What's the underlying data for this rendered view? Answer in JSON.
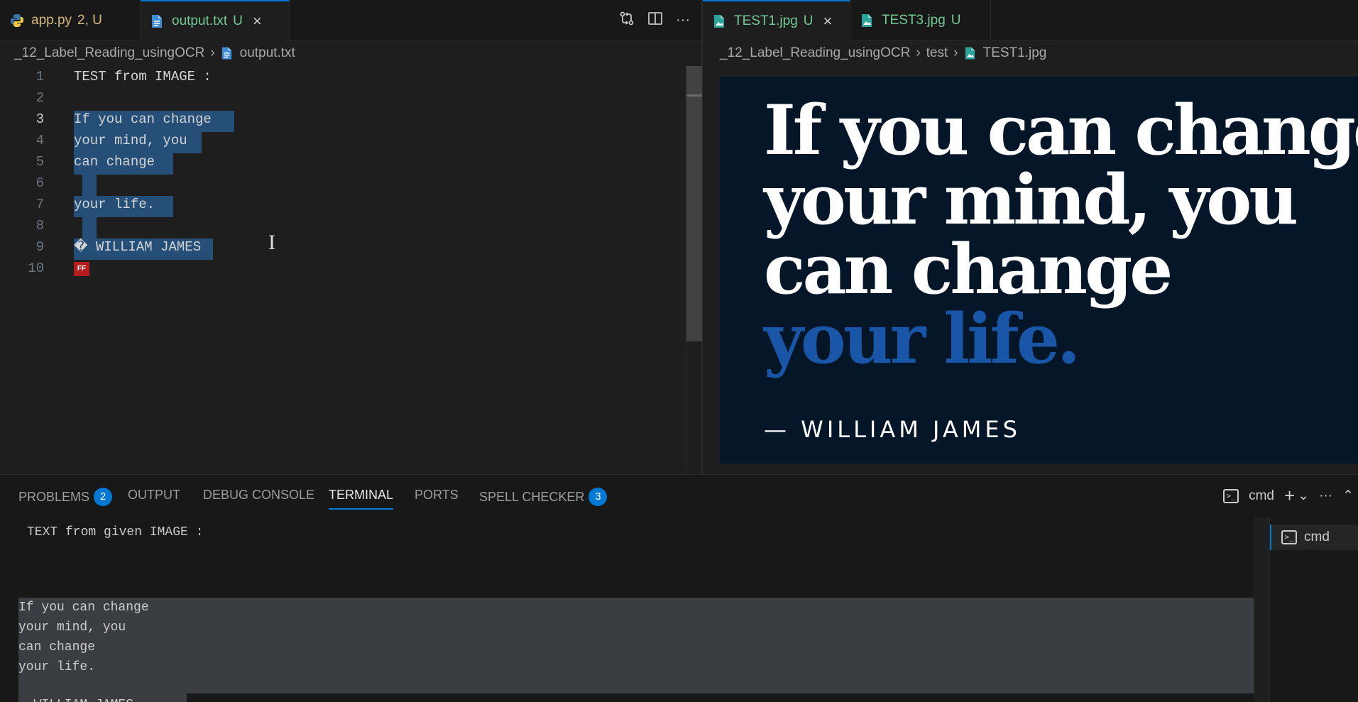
{
  "colors": {
    "accent": "#0078d4",
    "selection": "#264f78",
    "modified": "#d7ba7d",
    "untracked": "#73c991",
    "image_bg": "#051629",
    "image_blue_text": "#1a56a8"
  },
  "left_group": {
    "tabs": [
      {
        "icon": "python-icon",
        "label": "app.py",
        "status": "2, U"
      },
      {
        "icon": "text-file-icon",
        "label": "output.txt",
        "status": "U",
        "close": "×"
      }
    ],
    "actions": [
      "compare-changes-icon",
      "split-editor-icon",
      "more-actions-icon"
    ],
    "more_label": "···",
    "breadcrumb": {
      "folder": "_12_Label_Reading_usingOCR",
      "file": "output.txt"
    }
  },
  "editor": {
    "lines": [
      {
        "n": "1",
        "text": "TEST from IMAGE :"
      },
      {
        "n": "2",
        "text": ""
      },
      {
        "n": "3",
        "text": "If you can change"
      },
      {
        "n": "4",
        "text": "your mind, you"
      },
      {
        "n": "5",
        "text": "can change"
      },
      {
        "n": "6",
        "text": ""
      },
      {
        "n": "7",
        "text": "your life."
      },
      {
        "n": "8",
        "text": ""
      },
      {
        "n": "9",
        "text": "� WILLIAM JAMES"
      },
      {
        "n": "10",
        "text": ""
      }
    ],
    "ff_marker": "FF",
    "cursor_symbol": "I"
  },
  "right_group": {
    "tabs": [
      {
        "icon": "image-file-icon",
        "label": "TEST1.jpg",
        "status": "U",
        "close": "×"
      },
      {
        "icon": "image-file-icon",
        "label": "TEST3.jpg",
        "status": "U"
      }
    ],
    "breadcrumb": {
      "folder": "_12_Label_Reading_usingOCR",
      "subfolder": "test",
      "file": "TEST1.jpg"
    }
  },
  "image_preview": {
    "lines_white": [
      "If you can change",
      "your mind, you",
      "can change"
    ],
    "line_blue": "your life.",
    "author": "— WILLIAM JAMES"
  },
  "panel": {
    "tabs": [
      {
        "label": "PROBLEMS",
        "badge": "2"
      },
      {
        "label": "OUTPUT"
      },
      {
        "label": "DEBUG CONSOLE"
      },
      {
        "label": "TERMINAL",
        "active": true
      },
      {
        "label": "PORTS"
      },
      {
        "label": "SPELL CHECKER",
        "badge": "3"
      }
    ],
    "shell_label": "cmd",
    "add_label": "+",
    "dropdown_label": "⌄",
    "more_label": "···",
    "collapse_label": "⌃",
    "terminal_lines": [
      "TEXT from given IMAGE :",
      "",
      "If you can change",
      "your mind, you",
      "can change",
      "",
      "your life.",
      "",
      "— WILLIAM JAMES"
    ],
    "terminal_list": [
      "cmd"
    ]
  }
}
